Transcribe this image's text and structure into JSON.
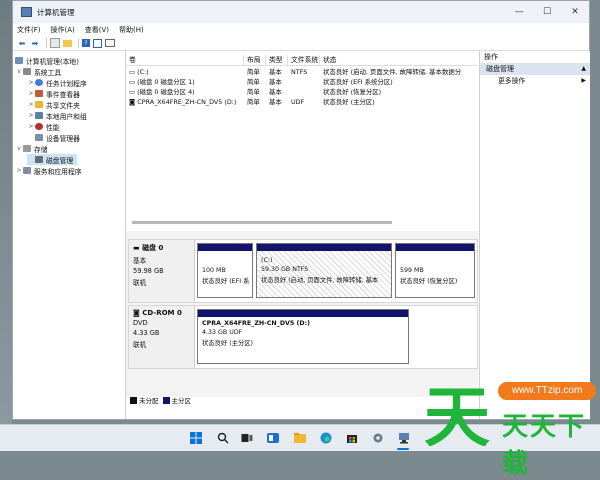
{
  "window": {
    "title": "计算机管理",
    "controls": {
      "min": "—",
      "max": "☐",
      "close": "✕"
    }
  },
  "menu": [
    "文件(F)",
    "操作(A)",
    "查看(V)",
    "帮助(H)"
  ],
  "tree": {
    "root": "计算机管理(本地)",
    "system_tools": "系统工具",
    "task_scheduler": "任务计划程序",
    "event_viewer": "事件查看器",
    "shared_folders": "共享文件夹",
    "local_users": "本地用户和组",
    "performance": "性能",
    "device_manager": "设备管理器",
    "storage": "存储",
    "disk_management": "磁盘管理",
    "services_apps": "服务和应用程序"
  },
  "volume_list": {
    "headers": [
      "卷",
      "布局",
      "类型",
      "文件系统",
      "状态"
    ],
    "rows": [
      [
        "(C:)",
        "简单",
        "基本",
        "NTFS",
        "状态良好 (启动, 页面文件, 故障转储, 基本数据分"
      ],
      [
        "(磁盘 0 磁盘分区 1)",
        "简单",
        "基本",
        "",
        "状态良好 (EFI 系统分区)"
      ],
      [
        "(磁盘 0 磁盘分区 4)",
        "简单",
        "基本",
        "",
        "状态良好 (恢复分区)"
      ],
      [
        "CPRA_X64FRE_ZH-CN_DV5 (D:)",
        "简单",
        "基本",
        "UDF",
        "状态良好 (主分区)"
      ]
    ]
  },
  "disk0": {
    "title": "磁盘 0",
    "type": "基本",
    "size": "59.98 GB",
    "status": "联机",
    "partitions": [
      {
        "name": "",
        "size": "100 MB",
        "status": "状态良好 (EFI 系"
      },
      {
        "name": "(C:)",
        "size": "59.30 GB NTFS",
        "status": "状态良好 (启动, 页面文件, 故障转储, 基本"
      },
      {
        "name": "",
        "size": "599 MB",
        "status": "状态良好 (恢复分区)"
      }
    ]
  },
  "cdrom0": {
    "title": "CD-ROM 0",
    "type": "DVD",
    "size": "4.33 GB",
    "status": "联机",
    "partition": {
      "name": "CPRA_X64FRE_ZH-CN_DV5 (D:)",
      "size": "4.33 GB UDF",
      "status": "状态良好 (主分区)"
    }
  },
  "legend": {
    "unallocated": "未分配",
    "primary": "主分区"
  },
  "actions": {
    "header": "操作",
    "section": "磁盘管理",
    "more": "更多操作"
  },
  "watermark": {
    "url": "www.TTzip.com",
    "text": "天天下载"
  },
  "colors": {
    "primary_partition": "#10146b",
    "accent": "#0078d4",
    "selection": "#cce4f7"
  },
  "taskbar_icons": [
    "windows-start-icon",
    "search-icon",
    "task-view-icon",
    "widgets-icon",
    "file-explorer-icon",
    "edge-icon",
    "store-icon",
    "settings-icon",
    "computer-management-icon"
  ]
}
